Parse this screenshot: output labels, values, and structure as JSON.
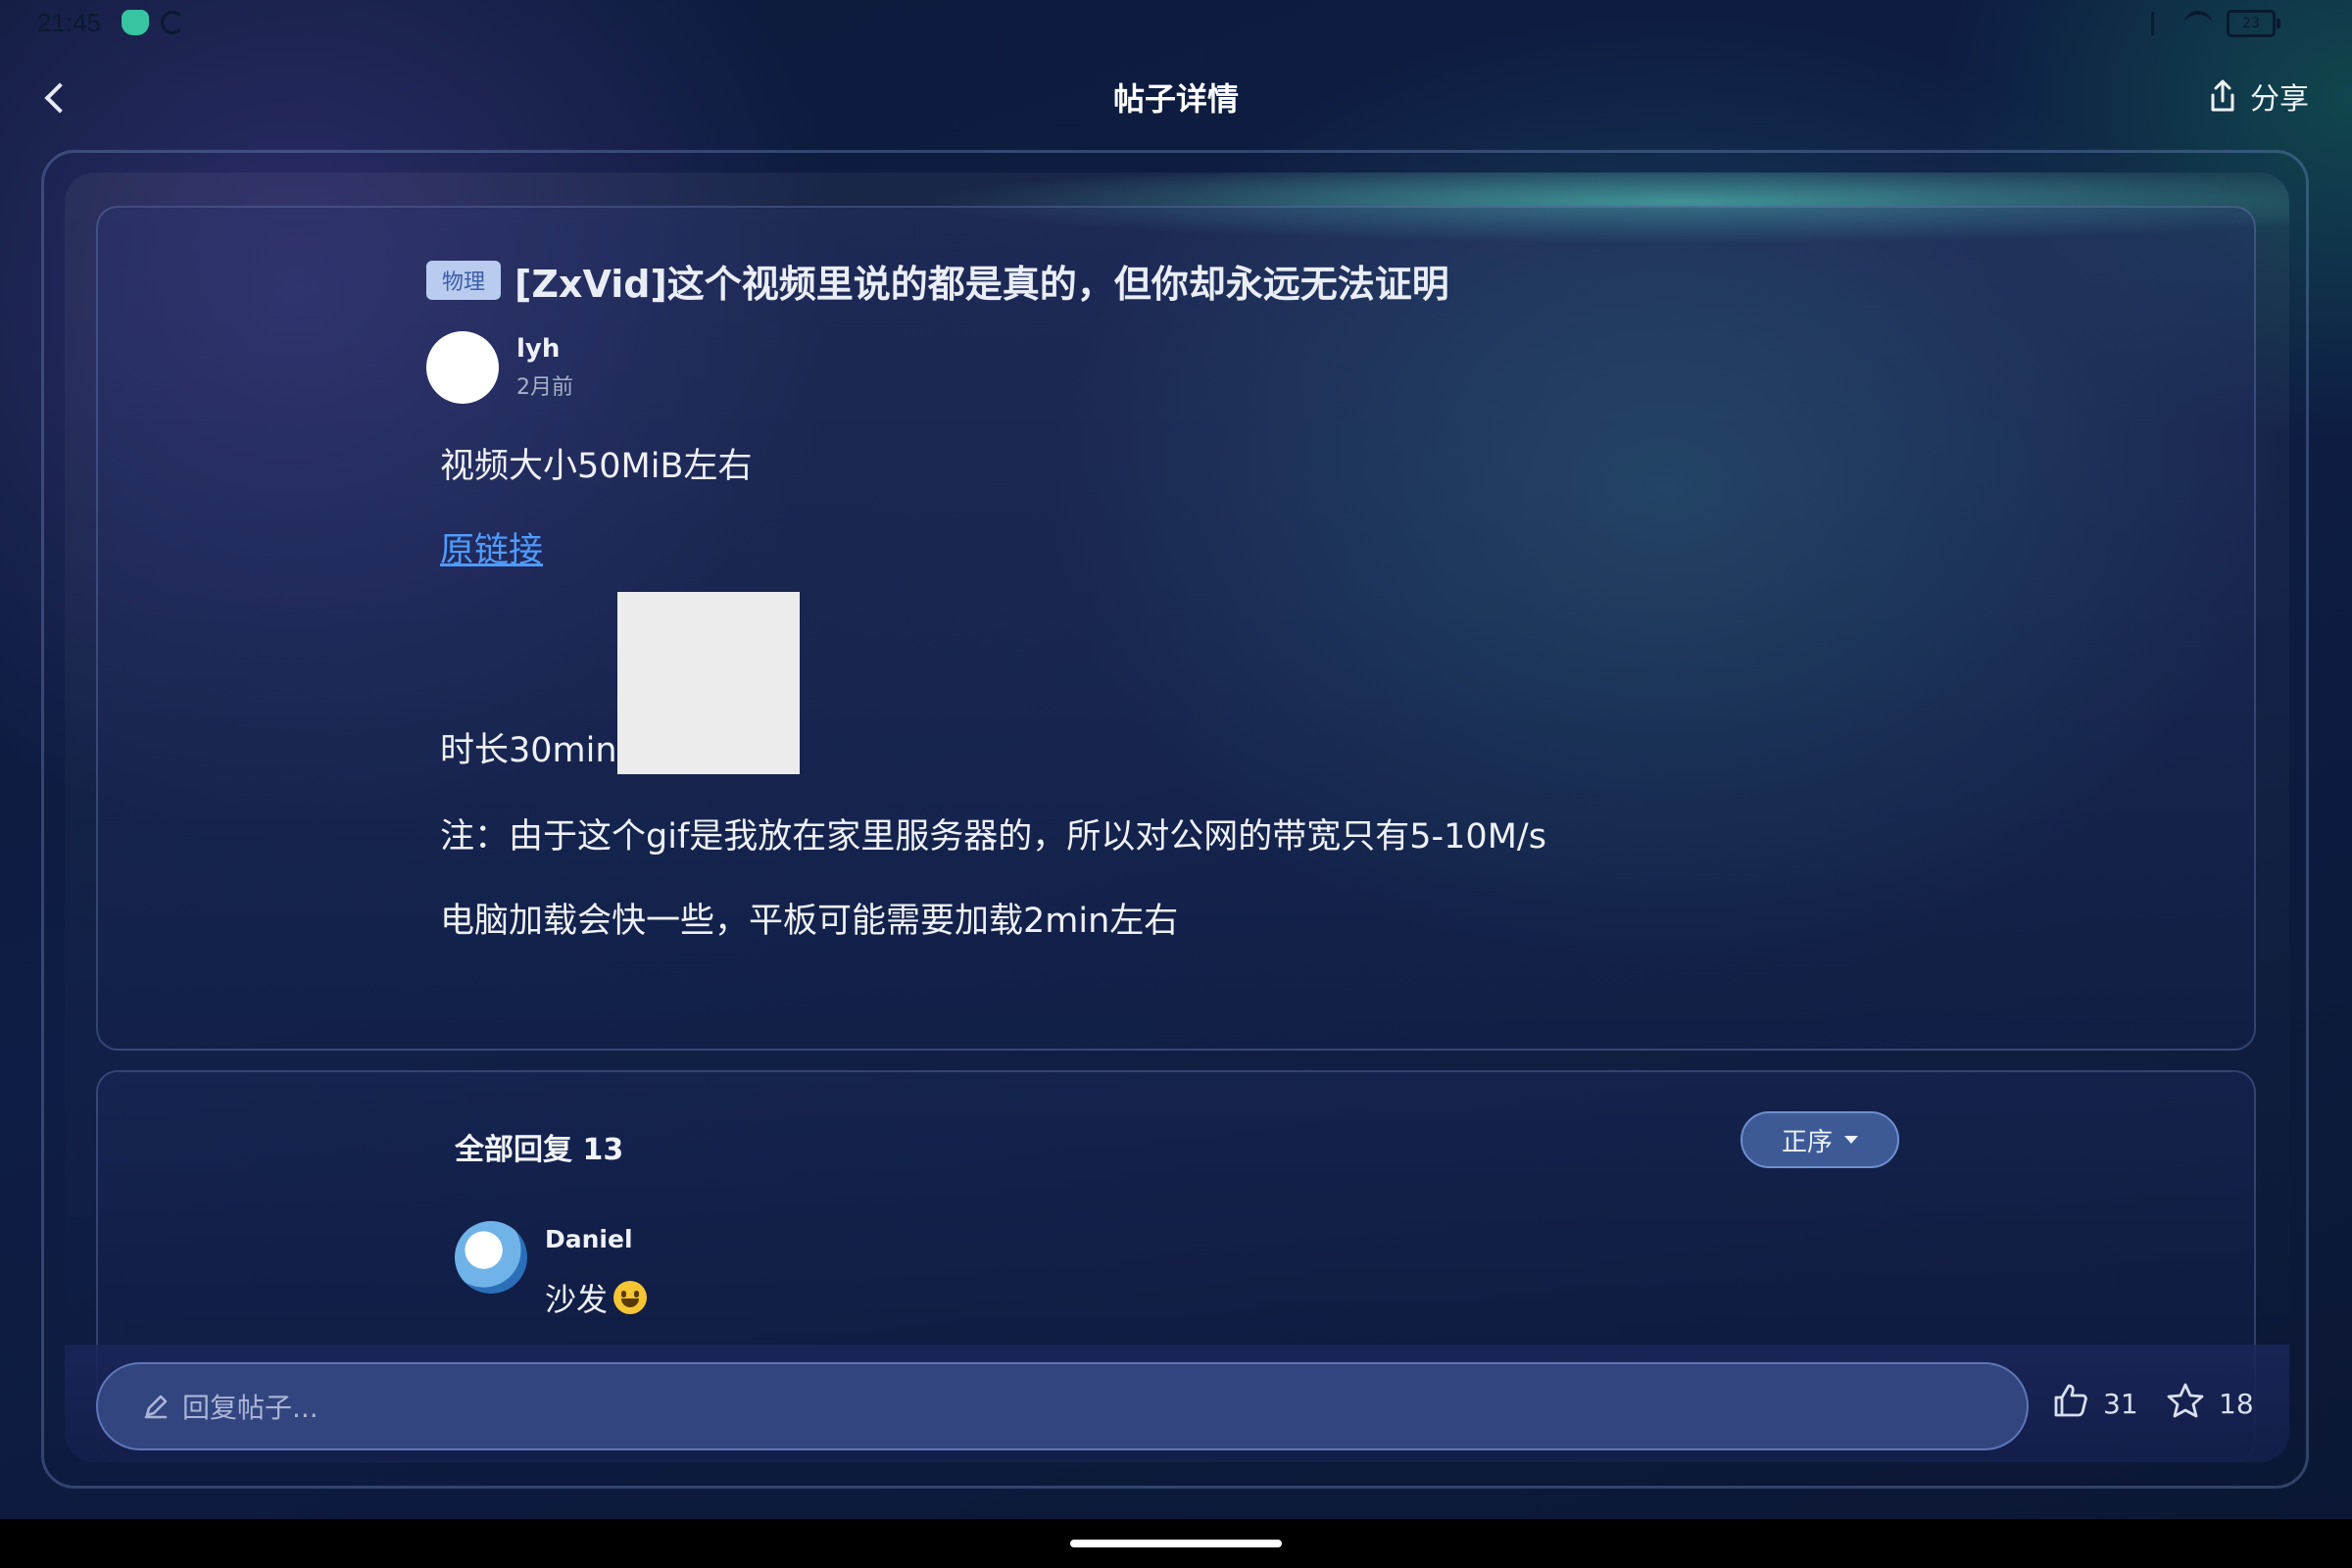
{
  "status_bar": {
    "time": "21:45",
    "battery": "23"
  },
  "header": {
    "title": "帖子详情",
    "share_label": "分享"
  },
  "post": {
    "category": "物理",
    "title": "[ZxVid]这个视频里说的都是真的，但你却永远无法证明",
    "author": "lyh",
    "time": "2月前",
    "body": {
      "size_line": "视频大小50MiB左右",
      "link_text": "原链接",
      "duration_line": "时长30min",
      "note_line_1": "注：由于这个gif是我放在家里服务器的，所以对公网的带宽只有5-10M/s",
      "note_line_2": "电脑加载会快一些，平板可能需要加载2min左右"
    }
  },
  "replies": {
    "header": "全部回复 13",
    "sort_label": "正序",
    "items": [
      {
        "name": "Daniel",
        "text": "沙发"
      }
    ]
  },
  "bottom": {
    "reply_placeholder": "回复帖子...",
    "like_count": "31",
    "favorite_count": "18"
  },
  "colors": {
    "accent_link": "#4f9cff",
    "tag_bg": "#b9cbef",
    "tag_text": "#3d5fa8"
  }
}
